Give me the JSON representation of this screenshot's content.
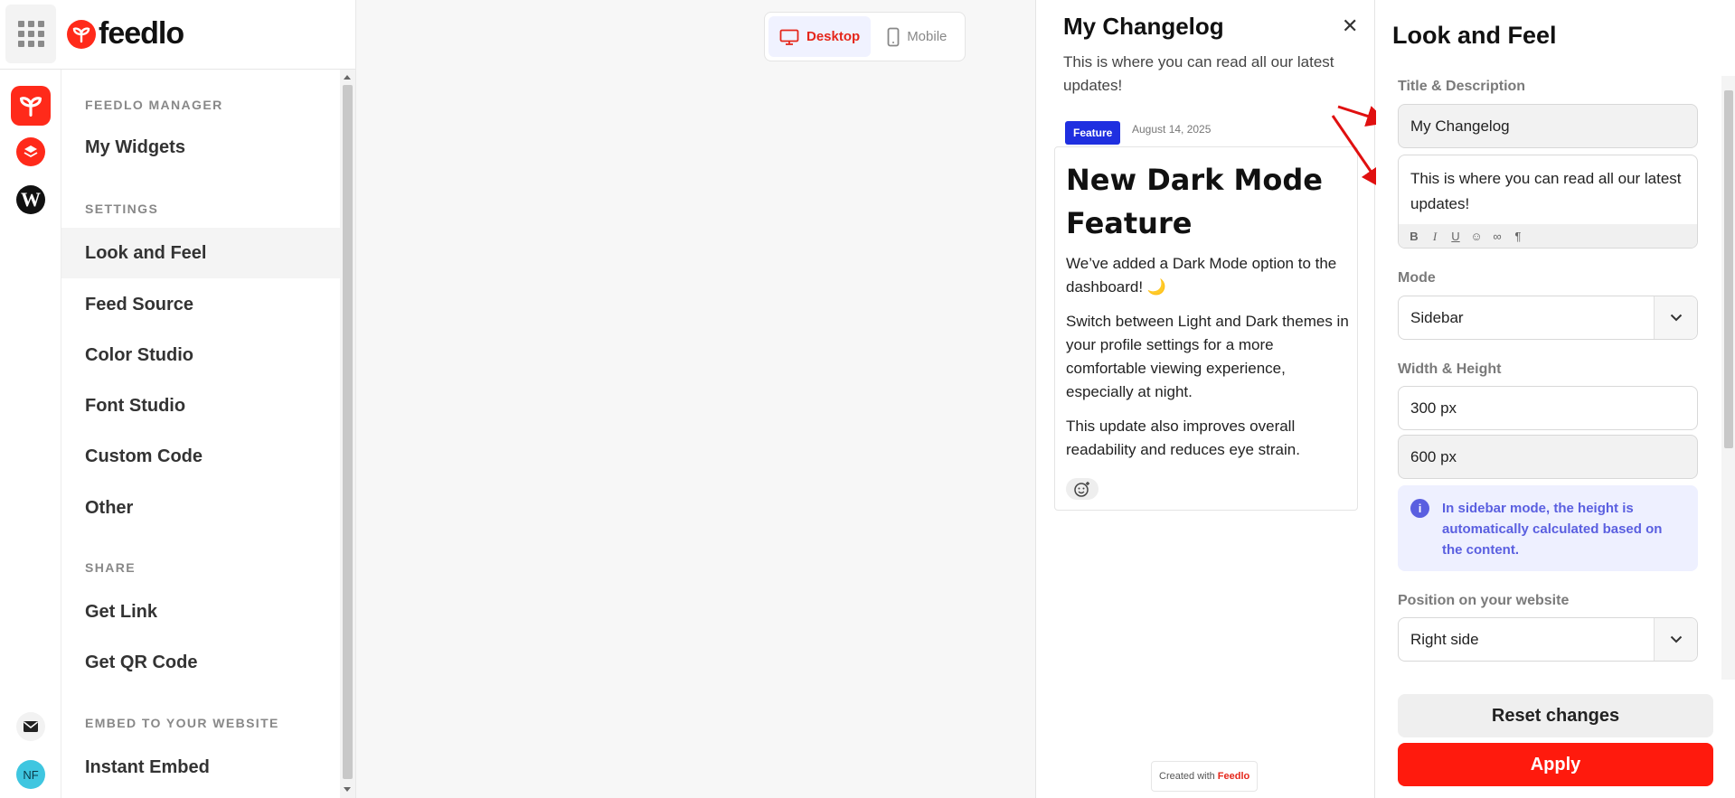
{
  "brand": {
    "name": "feedlo",
    "accent": "#ff2a1a"
  },
  "nav": {
    "section_manager": "FEEDLO MANAGER",
    "my_widgets": "My Widgets",
    "section_settings": "SETTINGS",
    "look_and_feel": "Look and Feel",
    "feed_source": "Feed Source",
    "color_studio": "Color Studio",
    "font_studio": "Font Studio",
    "custom_code": "Custom Code",
    "other": "Other",
    "section_share": "SHARE",
    "get_link": "Get Link",
    "get_qr_code": "Get QR Code",
    "section_embed": "EMBED TO YOUR WEBSITE",
    "instant_embed": "Instant Embed"
  },
  "rail": {
    "avatar_initials": "NF"
  },
  "device_toggle": {
    "desktop": "Desktop",
    "mobile": "Mobile",
    "selected": "Desktop"
  },
  "widget": {
    "title": "My Changelog",
    "description": "This is where you can read all our latest updates!",
    "post": {
      "badge": "Feature",
      "date": "August 14, 2025",
      "title": "New Dark Mode Feature",
      "p1": "We’ve added a Dark Mode option to the dashboard! 🌙",
      "p2": "Switch between Light and Dark themes in your profile settings for a more comfortable viewing experience, especially at night.",
      "p3": "This update also improves overall readability and reduces eye strain."
    },
    "created_prefix": "Created with",
    "created_brand": "Feedlo"
  },
  "settings": {
    "title": "Look and Feel",
    "title_desc_label": "Title & Description",
    "title_value": "My Changelog",
    "description_value": "This is where you can read all our latest updates!",
    "mode_label": "Mode",
    "mode_value": "Sidebar",
    "width_height_label": "Width & Height",
    "width_value": "300 px",
    "height_value": "600 px",
    "info_text": "In sidebar mode, the height is automatically calculated based on the content.",
    "position_label": "Position on your website",
    "position_value": "Right side",
    "reset_label": "Reset changes",
    "apply_label": "Apply"
  }
}
